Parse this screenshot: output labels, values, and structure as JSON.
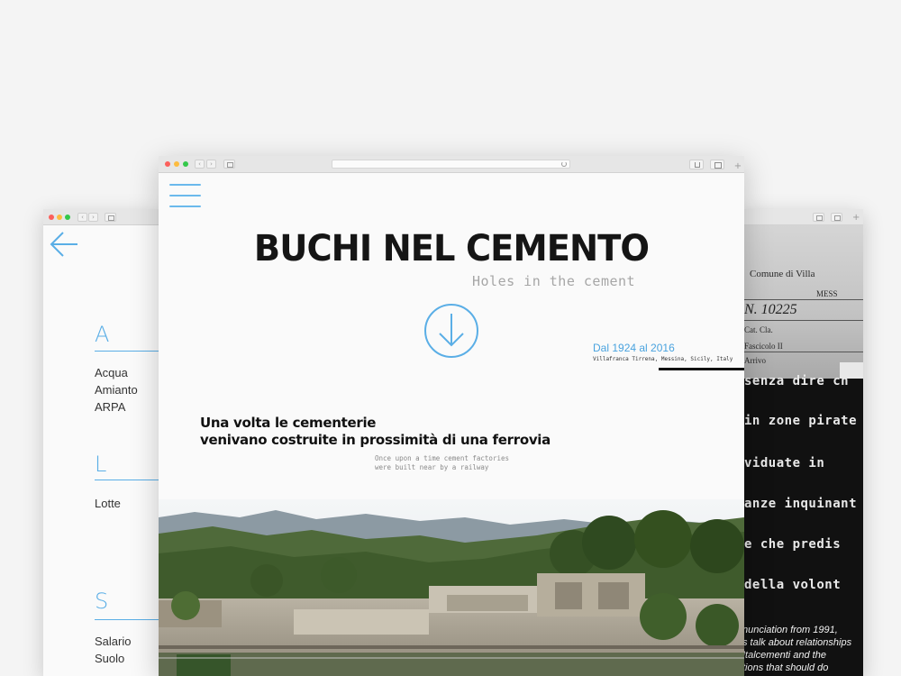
{
  "colors": {
    "accent": "#5aaee6",
    "title": "#151515",
    "background": "#f4f4f4"
  },
  "glossary": {
    "back_icon": "arrow-left-icon",
    "sections": [
      {
        "letter": "A",
        "items": [
          "Acqua",
          "Amianto",
          "ARPA"
        ]
      },
      {
        "letter": "L",
        "items": [
          "Lotte"
        ]
      },
      {
        "letter": "S",
        "items": [
          "Salario",
          "Suolo"
        ]
      }
    ]
  },
  "main": {
    "menu_icon": "hamburger-menu-icon",
    "title": "BUCHI NEL CEMENTO",
    "subtitle": "Holes in the cement",
    "scroll_icon": "arrow-down-circle-icon",
    "date_range": "Dal 1924 al 2016",
    "location": "Villafranca Tirrena, Messina, Sicily, Italy",
    "intro_line1": "Una volta le cementerie",
    "intro_line2": "venivano costruite in prossimità di una ferrovia",
    "intro_en_line1": "Once upon a time cement factories",
    "intro_en_line2": "were built near by a railway"
  },
  "document": {
    "header_lines": [
      "Comune di Villa",
      "MESS",
      "N. 10225",
      "Cat.      Cla.",
      "Fascicolo  II",
      "Arrivo"
    ],
    "typed_lines": [
      "senza dire ch",
      "in zone pirate",
      "viduate  in",
      "anze inquinant",
      "e che  predis",
      "della volont"
    ],
    "caption_lines": [
      "nunciation from 1991,",
      "s talk about relationships",
      "Italcementi and the",
      "tions that should do"
    ]
  }
}
